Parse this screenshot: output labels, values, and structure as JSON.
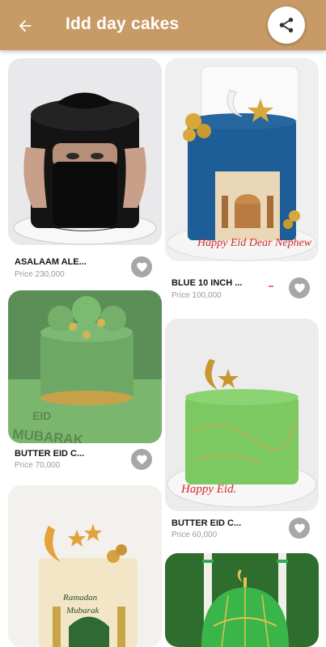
{
  "appbar": {
    "title": "Idd day cakes",
    "back_icon": "arrow-left-icon",
    "share_icon": "share-icon",
    "background": "#c79a66"
  },
  "products": [
    {
      "name": "ASALAAM ALE...",
      "price": "Price 230,000",
      "image": "black niqab cake"
    },
    {
      "name": "BLUE 10 INCH ...",
      "price": "Price 100,000",
      "image": "blue cake with mosque print"
    },
    {
      "name": "BUTTER EID C...",
      "price": "Price 70,000",
      "image": "green Eid Mubarak cake"
    },
    {
      "name": "BUTTER EID C...",
      "price": "Price 60,000",
      "image": "green cake with gold moon"
    },
    {
      "name": "",
      "price": "",
      "image": "Ramadan Mubarak cake"
    },
    {
      "name": "",
      "price": "",
      "image": "green dome cake"
    }
  ],
  "colors": {
    "fav_bg": "#a7a7a7",
    "price_text": "#9a9a9a"
  }
}
